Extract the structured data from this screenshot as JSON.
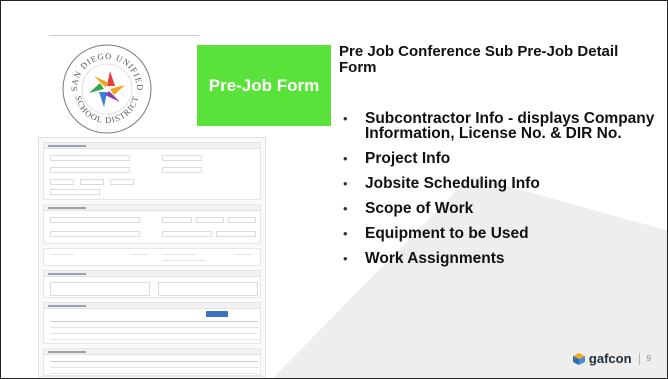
{
  "badge": {
    "label": "Pre-Job Form"
  },
  "logo": {
    "top_text": "SAN DIEGO UNIFIED",
    "bottom_text": "SCHOOL DISTRICT"
  },
  "slide": {
    "title": "Pre Job Conference Sub Pre-Job Detail Form",
    "bullets": [
      "Subcontractor Info - displays Company Information, License No. & DIR No.",
      "Project Info",
      "Jobsite Scheduling Info",
      "Scope of Work",
      "Equipment to be Used",
      "Work Assignments"
    ]
  },
  "footer": {
    "brand": "gafcon",
    "page_number": "9"
  },
  "colors": {
    "badge_green": "#59e23a",
    "brand_orange": "#f5a623",
    "brand_blue": "#2f6db5"
  },
  "icons": {
    "logo": "star-pinwheel-seal",
    "brand": "gafcon-cube-icon"
  }
}
